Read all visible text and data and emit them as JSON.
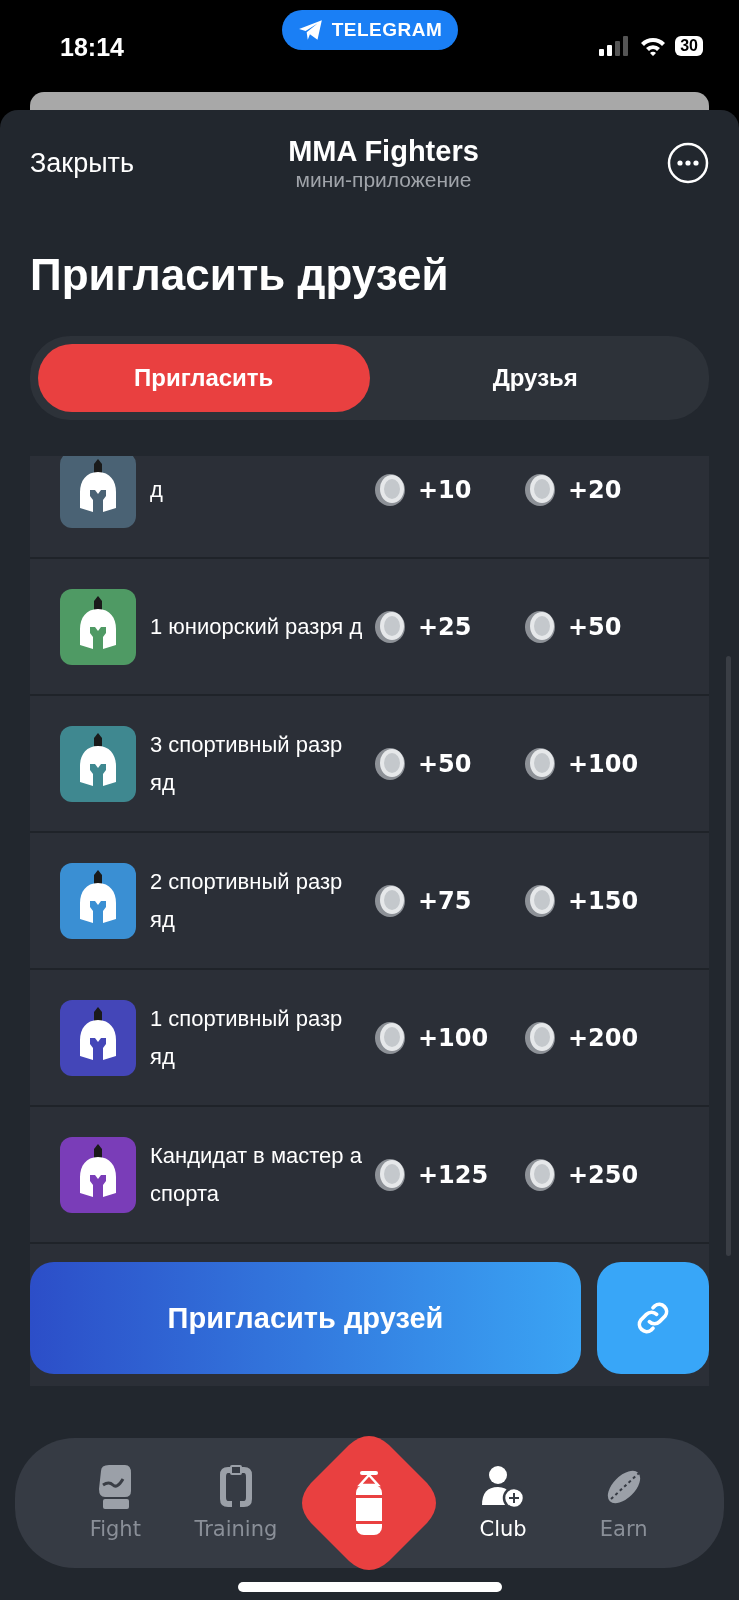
{
  "status_bar": {
    "time": "18:14",
    "pill": "TELEGRAM",
    "battery": "30"
  },
  "header": {
    "close": "Закрыть",
    "title": "MMA Fighters",
    "subtitle": "мини-приложение"
  },
  "page_title": "Пригласить друзей",
  "tabs": [
    {
      "label": "Пригласить",
      "selected": true
    },
    {
      "label": "Друзья",
      "selected": false
    }
  ],
  "ranks": [
    {
      "name": "д",
      "color": "#4a6274",
      "reward_1": "+10",
      "reward_2": "+20"
    },
    {
      "name": "1 юниорский разря д",
      "color": "#4f9a64",
      "reward_1": "+25",
      "reward_2": "+50"
    },
    {
      "name": "3 спортивный разр яд",
      "color": "#3f8890",
      "reward_1": "+50",
      "reward_2": "+100"
    },
    {
      "name": "2 спортивный разр яд",
      "color": "#3a8fd3",
      "reward_1": "+75",
      "reward_2": "+150"
    },
    {
      "name": "1 спортивный разр яд",
      "color": "#4446b8",
      "reward_1": "+100",
      "reward_2": "+200"
    },
    {
      "name": "Кандидат в мастер а спорта",
      "color": "#7a3db8",
      "reward_1": "+125",
      "reward_2": "+250"
    }
  ],
  "invite_button": "Пригласить друзей",
  "nav": [
    {
      "label": "Fight",
      "kind": "glove",
      "selected": false
    },
    {
      "label": "Training",
      "kind": "belt",
      "selected": false
    },
    {
      "label": "Club",
      "kind": "club",
      "selected": true
    },
    {
      "label": "Earn",
      "kind": "coin",
      "selected": false
    }
  ]
}
